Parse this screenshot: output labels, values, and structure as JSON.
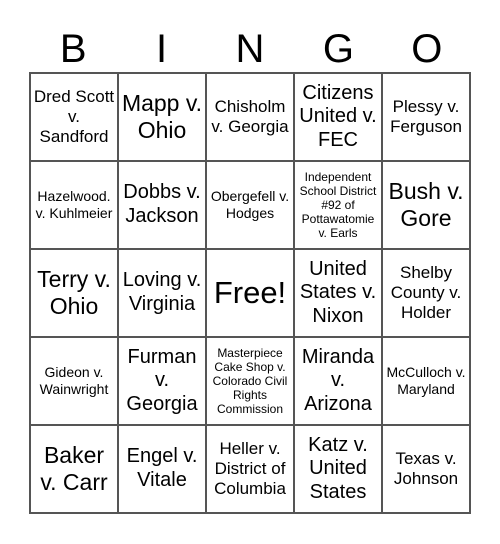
{
  "header": {
    "letters": [
      "B",
      "I",
      "N",
      "G",
      "O"
    ]
  },
  "cells": [
    {
      "text": "Dred Scott v. Sandford",
      "size": "m"
    },
    {
      "text": "Mapp v. Ohio",
      "size": "xl"
    },
    {
      "text": "Chisholm v. Georgia",
      "size": "m"
    },
    {
      "text": "Citizens United v. FEC",
      "size": "l"
    },
    {
      "text": "Plessy v. Ferguson",
      "size": "m"
    },
    {
      "text": "Hazelwood. v. Kuhlmeier",
      "size": "s"
    },
    {
      "text": "Dobbs v. Jackson",
      "size": "l"
    },
    {
      "text": "Obergefell v. Hodges",
      "size": "s"
    },
    {
      "text": "Independent School District #92 of Pottawatomie v. Earls",
      "size": "xs"
    },
    {
      "text": "Bush v. Gore",
      "size": "xl"
    },
    {
      "text": "Terry v. Ohio",
      "size": "xl"
    },
    {
      "text": "Loving v. Virginia",
      "size": "l"
    },
    {
      "text": "Free!",
      "size": "free"
    },
    {
      "text": "United States v. Nixon",
      "size": "l"
    },
    {
      "text": "Shelby County v. Holder",
      "size": "m"
    },
    {
      "text": "Gideon v. Wainwright",
      "size": "s"
    },
    {
      "text": "Furman v. Georgia",
      "size": "l"
    },
    {
      "text": "Masterpiece Cake Shop v. Colorado Civil Rights Commission",
      "size": "xs"
    },
    {
      "text": "Miranda v. Arizona",
      "size": "l"
    },
    {
      "text": "McCulloch v. Maryland",
      "size": "s"
    },
    {
      "text": "Baker v. Carr",
      "size": "xl"
    },
    {
      "text": "Engel v. Vitale",
      "size": "l"
    },
    {
      "text": "Heller v. District of Columbia",
      "size": "m"
    },
    {
      "text": "Katz v. United States",
      "size": "l"
    },
    {
      "text": "Texas v. Johnson",
      "size": "m"
    }
  ]
}
